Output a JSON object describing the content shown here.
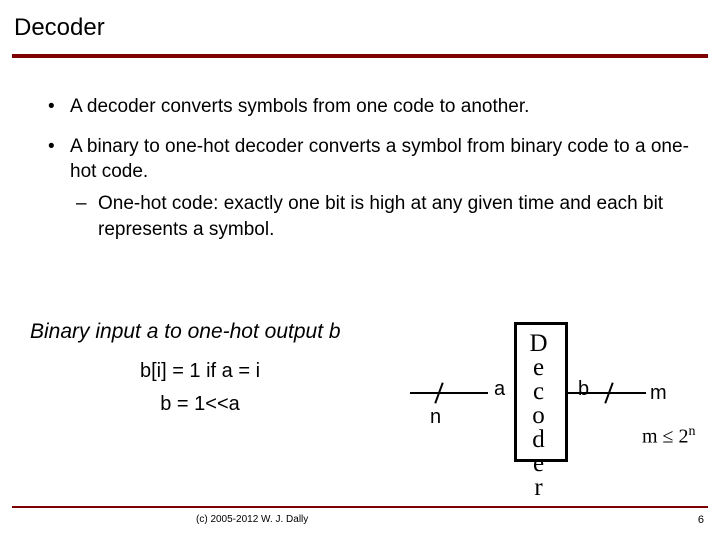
{
  "title": "Decoder",
  "bullets": [
    {
      "text": "A decoder converts symbols from one code to another."
    },
    {
      "text": "A binary to one-hot decoder converts a symbol from binary code to a one-hot code.",
      "sub": [
        "One-hot code: exactly one bit is high at any given time and each bit represents a symbol."
      ]
    }
  ],
  "caption": "Binary input a to one-hot output b",
  "formula1": "b[i] = 1 if a = i",
  "formula2": "b = 1<<a",
  "diagram": {
    "n": "n",
    "a": "a",
    "box": "Decoder",
    "b": "b",
    "m": "m",
    "constraint_lhs": "m ≤ ",
    "constraint_base": "2",
    "constraint_exp": "n"
  },
  "footer": {
    "copyright": "(c) 2005-2012 W. J. Dally",
    "pagenum": "6"
  }
}
